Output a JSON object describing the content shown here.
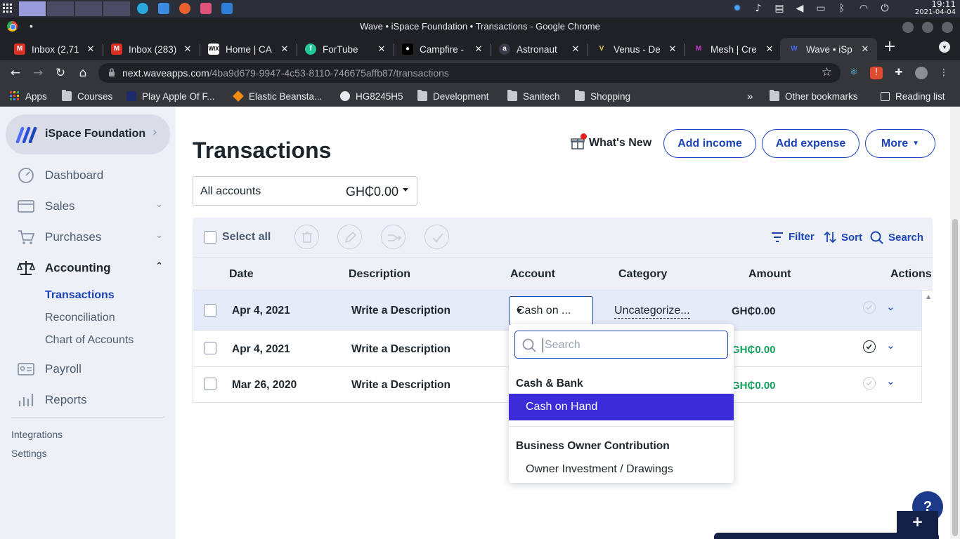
{
  "os": {
    "clock_time": "19:11",
    "clock_date": "2021-04-04"
  },
  "window": {
    "title": "Wave • iSpace Foundation • Transactions - Google Chrome"
  },
  "tabs": [
    {
      "label": "Inbox (2,71",
      "icon": "gmail-icon"
    },
    {
      "label": "Inbox (283)",
      "icon": "gmail-icon"
    },
    {
      "label": "Home | CA",
      "icon": "wix-icon"
    },
    {
      "label": "ForTube",
      "icon": "fortube-icon"
    },
    {
      "label": "Campfire -",
      "icon": "campfire-icon"
    },
    {
      "label": "Astronaut",
      "icon": "astronaut-icon"
    },
    {
      "label": "Venus - De",
      "icon": "venus-icon"
    },
    {
      "label": "Mesh | Cre",
      "icon": "mesh-icon"
    },
    {
      "label": "Wave • iSp",
      "icon": "wave-icon",
      "active": true
    }
  ],
  "toolbar": {
    "url_host": "next.waveapps.com",
    "url_path": "/4ba9d679-9947-4c53-8110-746675affb87/transactions"
  },
  "bookmarks": {
    "apps": "Apps",
    "courses": "Courses",
    "play_apple": "Play Apple Of F...",
    "elastic": "Elastic Beansta...",
    "hg": "HG8245H5",
    "development": "Development",
    "sanitech": "Sanitech",
    "shopping": "Shopping",
    "overflow": "»",
    "other": "Other bookmarks",
    "reading": "Reading list"
  },
  "sidebar": {
    "business_name": "iSpace Foundation",
    "items": {
      "dashboard": "Dashboard",
      "sales": "Sales",
      "purchases": "Purchases",
      "accounting": "Accounting",
      "payroll": "Payroll",
      "reports": "Reports"
    },
    "accounting_sub": {
      "transactions": "Transactions",
      "reconciliation": "Reconciliation",
      "chart_of_accounts": "Chart of Accounts"
    },
    "footer": {
      "integrations": "Integrations",
      "settings": "Settings"
    }
  },
  "header": {
    "title": "Transactions",
    "whats_new": "What's New",
    "add_income": "Add income",
    "add_expense": "Add expense",
    "more": "More"
  },
  "account_filter": {
    "label": "All accounts",
    "balance": "GH₵0.00"
  },
  "table_toolbar": {
    "select_all": "Select all",
    "filter": "Filter",
    "sort": "Sort",
    "search": "Search"
  },
  "columns": {
    "date": "Date",
    "description": "Description",
    "account": "Account",
    "category": "Category",
    "amount": "Amount",
    "actions": "Actions"
  },
  "rows": [
    {
      "date": "Apr 4, 2021",
      "description": "Write a Description",
      "account": "Cash on ...",
      "category": "Uncategorize...",
      "amount": "GH₵0.00",
      "reviewed": false
    },
    {
      "date": "Apr 4, 2021",
      "description": "Write a Description",
      "amount": "GH₵0.00",
      "reviewed": true
    },
    {
      "date": "Mar 26, 2020",
      "description": "Write a Description",
      "amount": "GH₵0.00",
      "reviewed": false
    }
  ],
  "account_menu": {
    "search_placeholder": "Search",
    "group1": "Cash & Bank",
    "option1": "Cash on Hand",
    "group2": "Business Owner Contribution",
    "option2": "Owner Investment / Drawings"
  },
  "widgets": {
    "help": "?",
    "feedback": "+"
  },
  "colors": {
    "brand_blue": "#1c45b8",
    "menu_active": "#3b2bd8",
    "positive_amount": "#13a05c",
    "sidebar_bg": "#edf0f7"
  }
}
